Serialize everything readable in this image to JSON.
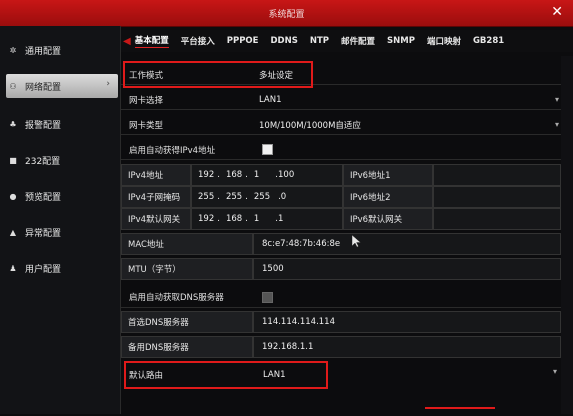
{
  "window": {
    "title": "系统配置",
    "close": "✕"
  },
  "sidebar": {
    "items": [
      {
        "icon": "✲",
        "label": "通用配置"
      },
      {
        "icon": "⚇",
        "label": "网络配置",
        "chevron": "›"
      },
      {
        "icon": "♣",
        "label": "报警配置"
      },
      {
        "icon": "■",
        "label": "232配置"
      },
      {
        "icon": "●",
        "label": "预览配置"
      },
      {
        "icon": "▲",
        "label": "异常配置"
      },
      {
        "icon": "♟",
        "label": "用户配置"
      }
    ]
  },
  "tabs": {
    "arrow": "◀",
    "items": [
      "基本配置",
      "平台接入",
      "PPPOE",
      "DDNS",
      "NTP",
      "邮件配置",
      "SNMP",
      "端口映射",
      "GB281"
    ]
  },
  "form": {
    "work_mode": {
      "label": "工作模式",
      "value": "多址设定"
    },
    "nic_select": {
      "label": "网卡选择",
      "value": "LAN1"
    },
    "nic_type": {
      "label": "网卡类型",
      "value": "10M/100M/1000M自适应"
    },
    "dhcp_ipv4": {
      "label": "启用自动获得IPv4地址"
    },
    "ipv4_addr": {
      "label": "IPv4地址",
      "a": "192",
      "b": "168",
      "c": "1",
      "d": ".100"
    },
    "ipv4_mask": {
      "label": "IPv4子网掩码",
      "a": "255",
      "b": "255",
      "c": "255",
      "d": ".0"
    },
    "ipv4_gw": {
      "label": "IPv4默认网关",
      "a": "192",
      "b": "168",
      "c": "1",
      "d": ".1"
    },
    "ipv6_addr1": {
      "label": "IPv6地址1"
    },
    "ipv6_addr2": {
      "label": "IPv6地址2"
    },
    "ipv6_gw": {
      "label": "IPv6默认网关"
    },
    "mac": {
      "label": "MAC地址",
      "value": "8c:e7:48:7b:46:8e"
    },
    "mtu": {
      "label": "MTU（字节）",
      "value": "1500"
    },
    "dhcp_dns": {
      "label": "启用自动获取DNS服务器"
    },
    "dns_pref": {
      "label": "首选DNS服务器",
      "value": "114.114.114.114"
    },
    "dns_alt": {
      "label": "备用DNS服务器",
      "value": "192.168.1.1"
    },
    "default_route": {
      "label": "默认路由",
      "value": "LAN1"
    },
    "dropdown_arrow": "▾"
  },
  "colors": {
    "accent": "#c81616",
    "highlight_box": "#e01a1a"
  }
}
